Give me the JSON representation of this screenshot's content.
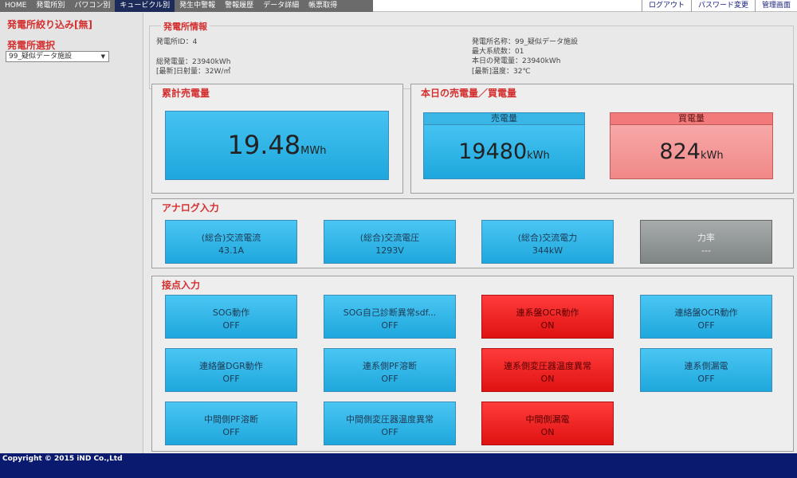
{
  "nav": {
    "tabs": [
      "HOME",
      "発電所別",
      "パワコン別",
      "キュービクル別",
      "発生中警報",
      "警報履歴",
      "データ詳細",
      "帳票取得"
    ],
    "links": [
      "ログアウト",
      "パスワード変更",
      "管理画面"
    ]
  },
  "sidebar": {
    "filter_label": "発電所絞り込み[無]",
    "select_label": "発電所選択",
    "select_value": "99_疑似データ施設"
  },
  "info": {
    "title": "発電所情報",
    "station_id": "発電所ID：4",
    "station_name": "発電所名称：99_疑似データ施設",
    "max_systems": "最大系統数：01",
    "total_power": "総発電量：23940kWh",
    "today_power": "本日の発電量：23940kWh",
    "latest_irradiance": "[最新]日射量：32W/㎡",
    "latest_temp": "[最新]温度：32℃"
  },
  "cumulative": {
    "title": "累計売電量",
    "value": "19.48",
    "unit": "MWh"
  },
  "today": {
    "title": "本日の売電量／買電量",
    "sell_label": "売電量",
    "sell_value": "19480",
    "sell_unit": "kWh",
    "buy_label": "買電量",
    "buy_value": "824",
    "buy_unit": "kWh"
  },
  "analog": {
    "title": "アナログ入力",
    "tiles": [
      {
        "label": "(総合)交流電流",
        "value": "43.1A"
      },
      {
        "label": "(総合)交流電圧",
        "value": "1293V"
      },
      {
        "label": "(総合)交流電力",
        "value": "344kW"
      },
      {
        "label": "力率",
        "value": "---"
      }
    ]
  },
  "contacts": {
    "title": "接点入力",
    "tiles": [
      {
        "label": "SOG動作",
        "value": "OFF"
      },
      {
        "label": "SOG自己診断異常sdf...",
        "value": "OFF"
      },
      {
        "label": "連系盤OCR動作",
        "value": "ON"
      },
      {
        "label": "連絡盤OCR動作",
        "value": "OFF"
      },
      {
        "label": "連絡盤DGR動作",
        "value": "OFF"
      },
      {
        "label": "連系側PF溶断",
        "value": "OFF"
      },
      {
        "label": "連系側変圧器温度異常",
        "value": "ON"
      },
      {
        "label": "連系側漏電",
        "value": "OFF"
      },
      {
        "label": "中間側PF溶断",
        "value": "OFF"
      },
      {
        "label": "中間側変圧器温度異常",
        "value": "OFF"
      },
      {
        "label": "中間側漏電",
        "value": "ON"
      }
    ]
  },
  "colors": {
    "accent_red": "#d32f2f",
    "tile_blue": "#1ea7dc",
    "tile_red": "#e01212",
    "tile_gray": "#7f8585",
    "buy_pink": "#f49a9a",
    "footer_navy": "#0a1a6e"
  },
  "footer": {
    "copyright": "Copyright © 2015 iND Co.,Ltd"
  }
}
